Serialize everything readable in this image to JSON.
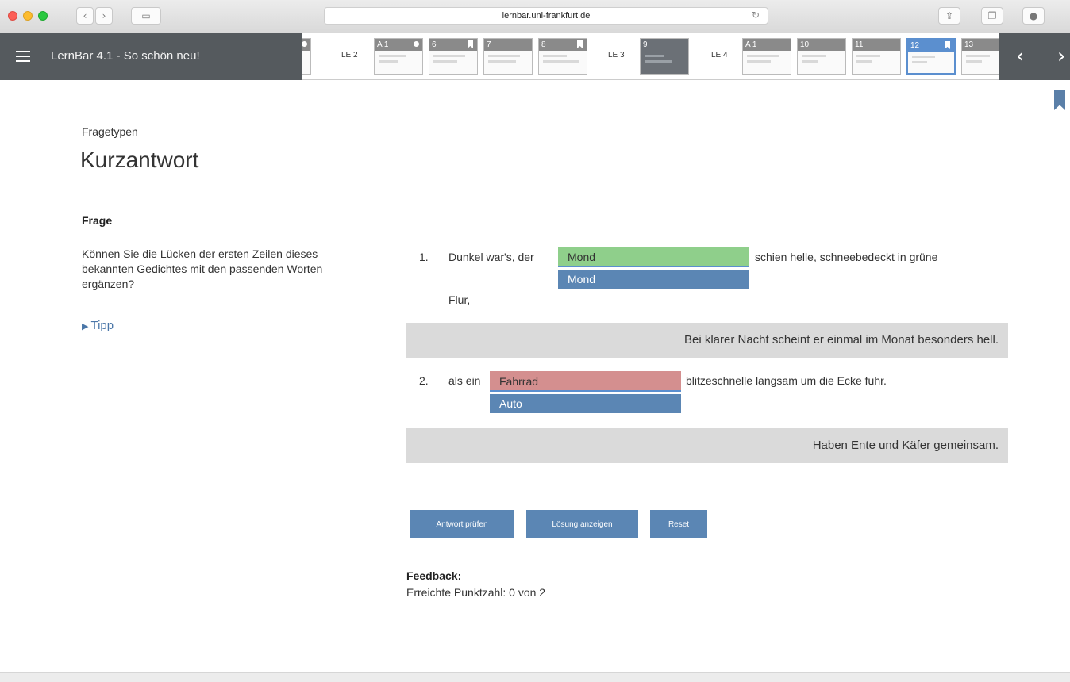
{
  "browser": {
    "url": "lernbar.uni-frankfurt.de",
    "reload_icon": "reload-icon",
    "buttons": [
      "share-icon",
      "tabs-icon",
      "download-icon"
    ]
  },
  "header": {
    "title": "LernBar 4.1 - So schön neu!",
    "sections": [
      {
        "label": "LE 2"
      },
      {
        "label": "LE 3"
      },
      {
        "label": "LE 4"
      }
    ],
    "thumbnails": [
      {
        "label": "A 1"
      },
      {
        "label": "6"
      },
      {
        "label": "7"
      },
      {
        "label": "8"
      },
      {
        "label": "9"
      },
      {
        "label": "A 1"
      },
      {
        "label": "10"
      },
      {
        "label": "11"
      },
      {
        "label": "12"
      },
      {
        "label": "13"
      }
    ],
    "active_thumbnail": "12",
    "prev_label": "‹",
    "next_label": "›"
  },
  "content": {
    "kicker": "Fragetypen",
    "title": "Kurzantwort",
    "question_heading": "Frage",
    "question_text": "Können Sie die Lücken der ersten Zeilen dieses bekannten Gedichtes mit den passenden Worten ergänzen?",
    "tipp_label": "Tipp"
  },
  "questions": [
    {
      "number": "1.",
      "before": "Dunkel war's, der",
      "answer": "Mond",
      "solution": "Mond",
      "after": "schien helle, schneebedeckt in grüne",
      "continuation": "Flur,",
      "hint": "Bei klarer Nacht scheint er einmal im Monat besonders hell.",
      "status": "correct"
    },
    {
      "number": "2.",
      "before": "als ein",
      "answer": "Fahrrad",
      "solution": "Auto",
      "after": "blitzeschnelle langsam um die Ecke fuhr.",
      "hint": "Haben Ente und Käfer gemeinsam.",
      "status": "wrong"
    }
  ],
  "buttons": {
    "check": "Antwort prüfen",
    "solution": "Lösung anzeigen",
    "reset": "Reset"
  },
  "feedback": {
    "heading": "Feedback:",
    "text": "Erreichte Punktzahl: 0 von 2"
  },
  "colors": {
    "header_bg": "#555a5e",
    "accent": "#5b86b4",
    "correct": "#8fcf8b",
    "wrong": "#d48f8f"
  }
}
